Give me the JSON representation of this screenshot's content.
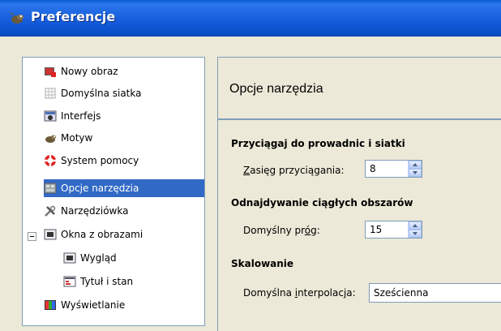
{
  "window": {
    "title": "Preferencje",
    "icon": "gimp-wilber-icon"
  },
  "tree": {
    "items": [
      {
        "label": "Nowy obraz",
        "icon": "new-image-icon"
      },
      {
        "label": "Domyślna siatka",
        "icon": "grid-icon"
      },
      {
        "label": "Interfejs",
        "icon": "interface-icon"
      },
      {
        "label": "Motyw",
        "icon": "theme-icon"
      },
      {
        "label": "System pomocy",
        "icon": "help-lifebuoy-icon"
      },
      {
        "label": "Opcje narzędzia",
        "icon": "tool-options-icon",
        "selected": true
      },
      {
        "label": "Narzędziówka",
        "icon": "toolbox-icon"
      },
      {
        "label": "Okna z obrazami",
        "icon": "image-window-icon",
        "expandable": true
      },
      {
        "label": "Wygląd",
        "icon": "appearance-icon"
      },
      {
        "label": "Tytuł i stan",
        "icon": "title-status-icon"
      },
      {
        "label": "Wyświetlanie",
        "icon": "display-icon"
      }
    ]
  },
  "page": {
    "title": "Opcje narzędzia",
    "sections": [
      {
        "title": "Przyciągaj do prowadnic i siatki",
        "field_label_pre": "",
        "field_label_mnemonic": "Z",
        "field_label_post": "asięg przyciągania:",
        "value": "8"
      },
      {
        "title": "Odnajdywanie ciągłych obszarów",
        "field_label_pre": "Domyślny pr",
        "field_label_mnemonic": "ó",
        "field_label_post": "g:",
        "value": "15"
      },
      {
        "title": "Skalowanie",
        "field_label_pre": "Domyślna ",
        "field_label_mnemonic": "i",
        "field_label_post": "nterpolacja:",
        "value": "Sześcienna"
      }
    ]
  },
  "colors": {
    "titlebar": "#0a5ad6",
    "selection": "#316ac5",
    "dialog_bg": "#ece9d8"
  }
}
